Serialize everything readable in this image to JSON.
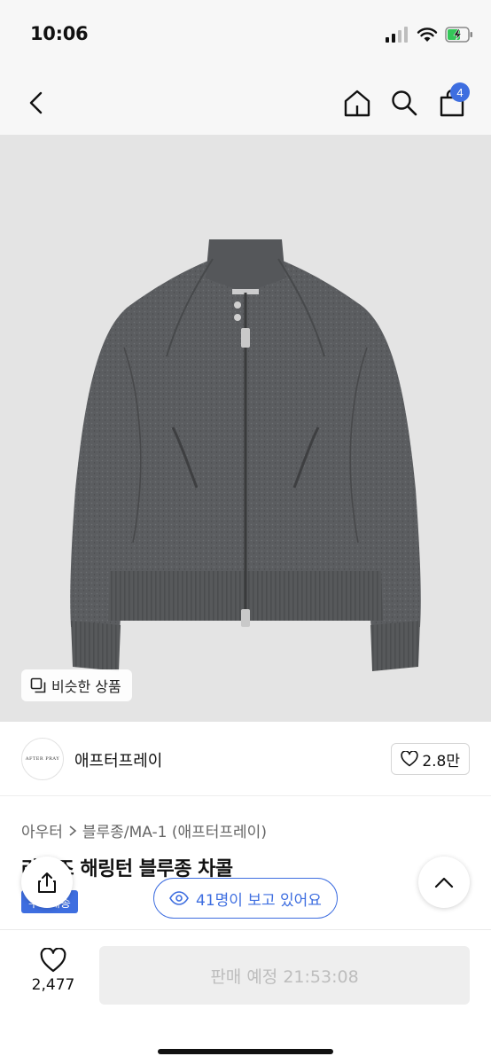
{
  "status_bar": {
    "time": "10:06"
  },
  "nav": {
    "cart_count": "4"
  },
  "image": {
    "logo_text": "AFTER PRAY",
    "similar_label": "비슷한 상품"
  },
  "brand": {
    "logo_text": "AFTER PRAY",
    "name": "애프터프레이",
    "like_count": "2.8만"
  },
  "breadcrumb": {
    "items": [
      "아우터",
      "블루종/MA-1 (애프터프레이)"
    ]
  },
  "product": {
    "title": "라이즈 해링턴 블루종 차콜",
    "badge": "무료배송"
  },
  "viewers": {
    "label": "41명이 보고 있어요"
  },
  "bottom": {
    "wish_count": "2,477",
    "sale_label": "판매 예정 21:53:08"
  },
  "colors": {
    "accent": "#3e6ee0",
    "jacket": "#5a5c5e"
  }
}
